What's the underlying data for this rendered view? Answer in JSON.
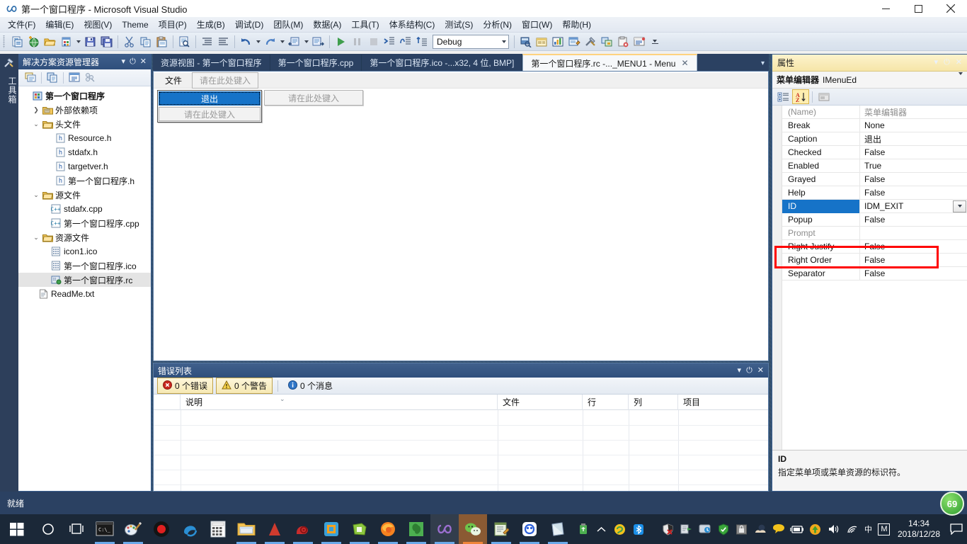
{
  "window": {
    "title": "第一个窗口程序 - Microsoft Visual Studio",
    "icon": "infinity-icon",
    "minimize": "minimize-button",
    "maximize": "maximize-button",
    "close": "close-button"
  },
  "menubar": {
    "items": [
      {
        "label": "文件(F)"
      },
      {
        "label": "编辑(E)"
      },
      {
        "label": "视图(V)"
      },
      {
        "label": "Theme"
      },
      {
        "label": "项目(P)"
      },
      {
        "label": "生成(B)"
      },
      {
        "label": "调试(D)"
      },
      {
        "label": "团队(M)"
      },
      {
        "label": "数据(A)"
      },
      {
        "label": "工具(T)"
      },
      {
        "label": "体系结构(C)"
      },
      {
        "label": "测试(S)"
      },
      {
        "label": "分析(N)"
      },
      {
        "label": "窗口(W)"
      },
      {
        "label": "帮助(H)"
      }
    ]
  },
  "toolbar": {
    "config_value": "Debug",
    "buttons": [
      "new-project-icon",
      "add-web-icon",
      "open-file-icon",
      "new-item-icon",
      "save-icon",
      "save-all-icon",
      "cut-icon",
      "copy-icon",
      "paste-icon",
      "find-icon",
      "indent-icon",
      "outdent-icon",
      "undo-icon",
      "redo-icon",
      "navigate-back-icon",
      "navigate-forward-icon",
      "start-debug-icon",
      "pause-icon",
      "stop-icon",
      "step-into-icon",
      "step-over-icon",
      "step-out-icon",
      "solution-explorer-icon",
      "properties-window-icon",
      "toolbox-icon",
      "object-browser-icon",
      "tools-icon",
      "class-view-icon",
      "error-list-icon",
      "output-window-icon"
    ]
  },
  "left_dock": {
    "tab_label": "工具箱",
    "icon": "toolbox-wrench-icon"
  },
  "solution_explorer": {
    "title": "解决方案资源管理器",
    "toolbar_buttons": [
      "properties-icon",
      "show-all-files-icon",
      "view-code-icon",
      "class-view-icon"
    ],
    "tree": [
      {
        "label": "第一个窗口程序",
        "icon": "project-icon",
        "indent": 0,
        "twist": "",
        "bold": true,
        "selected": false
      },
      {
        "label": "外部依赖项",
        "icon": "folder-ref-icon",
        "indent": 1,
        "twist": "collapsed",
        "bold": false,
        "selected": false
      },
      {
        "label": "头文件",
        "icon": "folder-icon",
        "indent": 1,
        "twist": "expanded",
        "bold": false,
        "selected": false
      },
      {
        "label": "Resource.h",
        "icon": "header-file-icon",
        "indent": 2,
        "twist": "",
        "bold": false,
        "selected": false
      },
      {
        "label": "stdafx.h",
        "icon": "header-file-icon",
        "indent": 2,
        "twist": "",
        "bold": false,
        "selected": false
      },
      {
        "label": "targetver.h",
        "icon": "header-file-icon",
        "indent": 2,
        "twist": "",
        "bold": false,
        "selected": false
      },
      {
        "label": "第一个窗口程序.h",
        "icon": "header-file-icon",
        "indent": 2,
        "twist": "",
        "bold": false,
        "selected": false
      },
      {
        "label": "源文件",
        "icon": "folder-icon",
        "indent": 1,
        "twist": "expanded",
        "bold": false,
        "selected": false
      },
      {
        "label": "stdafx.cpp",
        "icon": "cpp-file-icon",
        "indent": 2,
        "twist": "",
        "bold": false,
        "selected": false
      },
      {
        "label": "第一个窗口程序.cpp",
        "icon": "cpp-file-icon",
        "indent": 2,
        "twist": "",
        "bold": false,
        "selected": false
      },
      {
        "label": "资源文件",
        "icon": "folder-icon",
        "indent": 1,
        "twist": "expanded",
        "bold": false,
        "selected": false
      },
      {
        "label": "icon1.ico",
        "icon": "ico-file-icon",
        "indent": 2,
        "twist": "",
        "bold": false,
        "selected": false
      },
      {
        "label": "第一个窗口程序.ico",
        "icon": "ico-file-icon",
        "indent": 2,
        "twist": "",
        "bold": false,
        "selected": false
      },
      {
        "label": "第一个窗口程序.rc",
        "icon": "rc-file-icon",
        "indent": 2,
        "twist": "",
        "bold": false,
        "selected": true
      },
      {
        "label": "ReadMe.txt",
        "icon": "txt-file-icon",
        "indent": 1,
        "twist": "",
        "bold": false,
        "selected": false
      }
    ]
  },
  "document_tabs": [
    {
      "label": "资源视图 - 第一个窗口程序",
      "active": false,
      "closable": false
    },
    {
      "label": "第一个窗口程序.cpp",
      "active": false,
      "closable": false
    },
    {
      "label": "第一个窗口程序.ico -...x32, 4 位, BMP]",
      "active": false,
      "closable": false
    },
    {
      "label": "第一个窗口程序.rc -..._MENU1 - Menu",
      "active": true,
      "closable": true
    }
  ],
  "menu_designer": {
    "top_menu_label": "文件",
    "top_placeholder": "请在此处键入",
    "dropdown_selected": "退出",
    "dropdown_placeholder": "请在此处键入",
    "submenu_placeholder": "请在此处键入"
  },
  "error_list": {
    "title": "错误列表",
    "errors_chip": "0 个错误",
    "warnings_chip": "0 个警告",
    "messages_chip": "0 个消息",
    "columns": [
      "",
      "说明",
      "文件",
      "行",
      "列",
      "项目"
    ]
  },
  "properties": {
    "title": "属性",
    "object": "菜单编辑器 IMenuEd",
    "object_bold": "菜单编辑器",
    "object_rest": "IMenuEd",
    "toolbar_buttons": [
      "categorized-icon",
      "alphabetical-icon",
      "property-pages-icon"
    ],
    "rows": [
      {
        "name": "(Name)",
        "value": "菜单编辑器",
        "dim": true,
        "selected": false
      },
      {
        "name": "Break",
        "value": "None",
        "dim": false,
        "selected": false
      },
      {
        "name": "Caption",
        "value": "退出",
        "dim": false,
        "selected": false
      },
      {
        "name": "Checked",
        "value": "False",
        "dim": false,
        "selected": false
      },
      {
        "name": "Enabled",
        "value": "True",
        "dim": false,
        "selected": false
      },
      {
        "name": "Grayed",
        "value": "False",
        "dim": false,
        "selected": false
      },
      {
        "name": "Help",
        "value": "False",
        "dim": false,
        "selected": false
      },
      {
        "name": "ID",
        "value": "IDM_EXIT",
        "dim": false,
        "selected": true
      },
      {
        "name": "Popup",
        "value": "False",
        "dim": false,
        "selected": false
      },
      {
        "name": "Prompt",
        "value": "",
        "dim": true,
        "selected": false
      },
      {
        "name": "Right Justify",
        "value": "False",
        "dim": false,
        "selected": false
      },
      {
        "name": "Right Order",
        "value": "False",
        "dim": false,
        "selected": false
      },
      {
        "name": "Separator",
        "value": "False",
        "dim": false,
        "selected": false
      }
    ],
    "description_title": "ID",
    "description_body": "指定菜单项或菜单资源的标识符。",
    "highlight_color": "#ff0000",
    "selection_color": "#1673c8"
  },
  "overlay_badge": {
    "text": "69"
  },
  "statusbar": {
    "text": "就绪"
  },
  "taskbar": {
    "start": "windows-start-icon",
    "items": [
      {
        "icon": "cortana-search-icon",
        "running": false
      },
      {
        "icon": "task-view-icon",
        "running": false
      },
      {
        "icon": "command-prompt-icon",
        "running": true
      },
      {
        "icon": "paint-icon",
        "running": true
      },
      {
        "icon": "recorder-icon",
        "running": false
      },
      {
        "icon": "edge-browser-icon",
        "running": false
      },
      {
        "icon": "calculator-icon",
        "running": false
      },
      {
        "icon": "file-explorer-icon",
        "running": true
      },
      {
        "icon": "maxthon-icon",
        "running": true
      },
      {
        "icon": "snail-icon",
        "running": true
      },
      {
        "icon": "vmware-icon",
        "running": true
      },
      {
        "icon": "notes-icon",
        "running": true
      },
      {
        "icon": "firefox-icon",
        "running": true
      },
      {
        "icon": "evernote-icon",
        "running": true
      },
      {
        "icon": "visual-studio-icon",
        "running": true
      },
      {
        "icon": "wechat-icon",
        "running": true
      },
      {
        "icon": "editor-icon",
        "running": true
      },
      {
        "icon": "baidu-netdisk-icon",
        "running": true
      },
      {
        "icon": "onenote-icon",
        "running": true
      }
    ],
    "tray": [
      {
        "icon": "usb-device-icon"
      },
      {
        "icon": "show-hidden-icons-chevron-icon"
      },
      {
        "icon": "sogou-icon"
      },
      {
        "icon": "bluetooth-icon"
      },
      {
        "icon": "security-shield-red-icon"
      },
      {
        "icon": "driver-icon"
      },
      {
        "icon": "network-update-icon"
      },
      {
        "icon": "green-shield-icon"
      },
      {
        "icon": "lock-icon"
      },
      {
        "icon": "weather-icon"
      },
      {
        "icon": "messenger-icon"
      },
      {
        "icon": "battery-icon"
      },
      {
        "icon": "update-icon"
      },
      {
        "icon": "volume-icon"
      },
      {
        "icon": "wifi-icon"
      }
    ],
    "ime_label": "中",
    "ime_mode": "M",
    "clock_time": "14:34",
    "clock_date": "2018/12/28",
    "notification": "action-center-icon"
  }
}
